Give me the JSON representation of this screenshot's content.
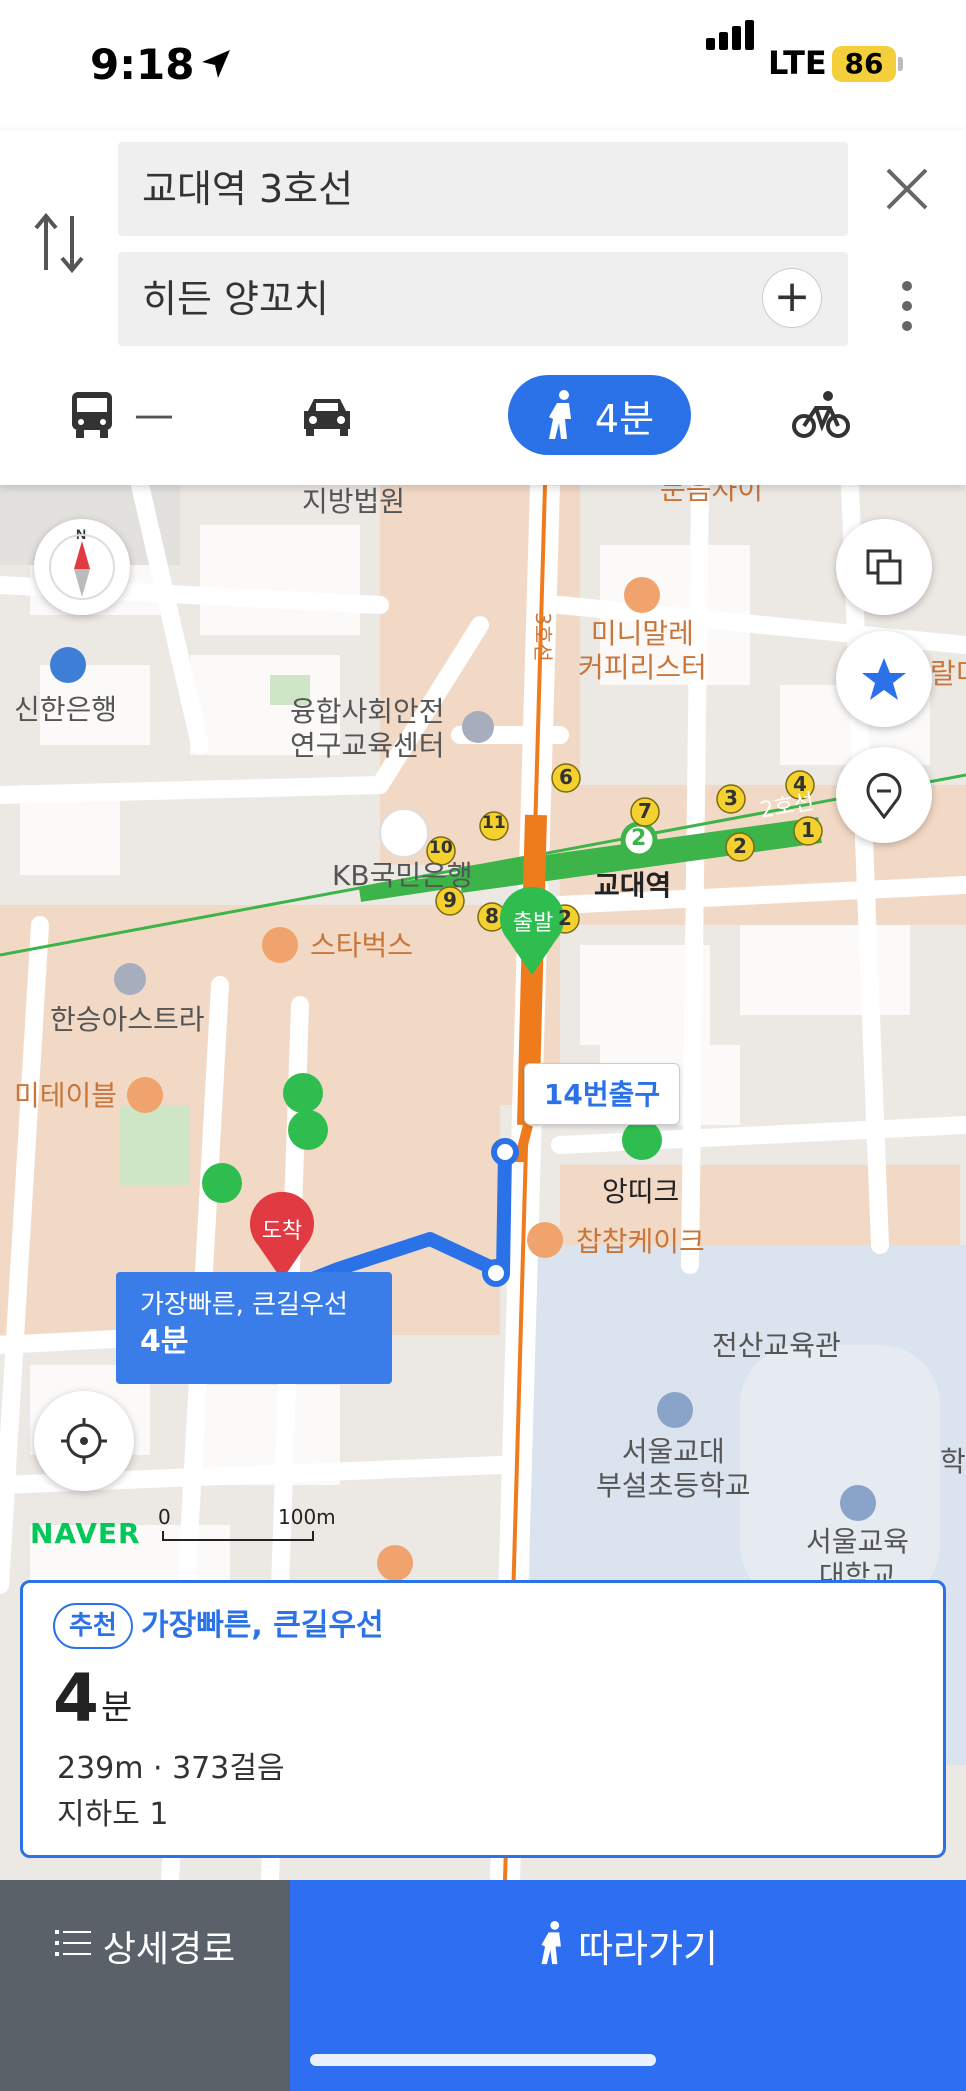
{
  "status": {
    "time": "9:18",
    "network": "LTE",
    "battery": "86"
  },
  "search": {
    "from": "교대역 3호선",
    "to": "히든 양꼬치"
  },
  "modes": {
    "bus_label": "—",
    "walk_label": "4분"
  },
  "map": {
    "labels": {
      "court": "지방법원",
      "top_orange": "문음자이",
      "line3": "3호선",
      "line2": "2호선",
      "cafe": "미니말레\n커피리스터",
      "shinhan": "신한은행",
      "center": "융합사회안전\n연구교육센터",
      "kb": "KB국민은행",
      "station": "교대역",
      "starbucks": "스타벅스",
      "hanseung": "한승아스트라",
      "meetable": "미테이블",
      "angtique": "앙띠크",
      "chapchap": "찹찹케이크",
      "edu_center": "전산교육관",
      "school": "서울교대\n부설초등학교",
      "seoul_edu": "서울교육\n대학교",
      "right_edge": "학",
      "right_edge2": "랄미"
    },
    "exits": [
      "6",
      "7",
      "3",
      "4",
      "2",
      "1",
      "11",
      "10",
      "9",
      "8",
      "2"
    ],
    "line2_badge": "2",
    "start_marker": "출발",
    "end_marker": "도착",
    "exit_label": "14번출구",
    "callout_line1": "가장빠른, 큰길우선",
    "callout_line2": "4분",
    "naver": "NAVER",
    "scale_zero": "0",
    "scale_label": "100m"
  },
  "route": {
    "badge": "추천",
    "title": "가장빠른, 큰길우선",
    "duration_num": "4",
    "duration_unit": "분",
    "distance": "239m · 373걸음",
    "sub": "지하도 1"
  },
  "bottom": {
    "detail_label": "상세경로",
    "follow_label": "따라가기"
  },
  "colors": {
    "accent": "#2b72e8",
    "line2": "#3cb44a",
    "line3": "#ef7c1c"
  }
}
